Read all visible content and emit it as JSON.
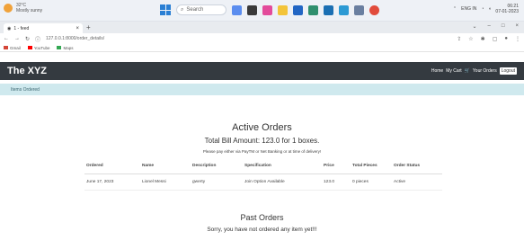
{
  "taskbar": {
    "weather_temp": "32°C",
    "weather_desc": "Mostly sunny",
    "search_label": "Search",
    "clock_time": "06:21",
    "clock_date": "07-01-2023",
    "lang": "ENG IN"
  },
  "browser": {
    "tab_title": "1 - feed",
    "url": "127.0.0.1:8000/order_details/",
    "bookmarks": [
      "Gmail",
      "YouTube",
      "Maps"
    ]
  },
  "navbar": {
    "brand": "The XYZ",
    "links": [
      "Home",
      "My Cart",
      "Your Orders"
    ],
    "logout_label": "Logout"
  },
  "alert": {
    "text": "Items Ordered"
  },
  "active": {
    "heading": "Active Orders",
    "total": "Total Bill Amount: 123.0 for 1 boxes.",
    "pay_note": "Please pay either via PayTM or Net Banking or at time of delivery!",
    "columns": [
      "Ordered",
      "Name",
      "Description",
      "Specification",
      "Price",
      "Total Pieces",
      "Order Status"
    ],
    "rows": [
      [
        "June 17, 2023",
        "Lionel Messi",
        "gwerty",
        "Join Option Available",
        "123.0",
        "0 pieces",
        "Active"
      ]
    ]
  },
  "past": {
    "heading": "Past Orders",
    "message": "Sorry, you have not ordered any item yet!!!"
  }
}
